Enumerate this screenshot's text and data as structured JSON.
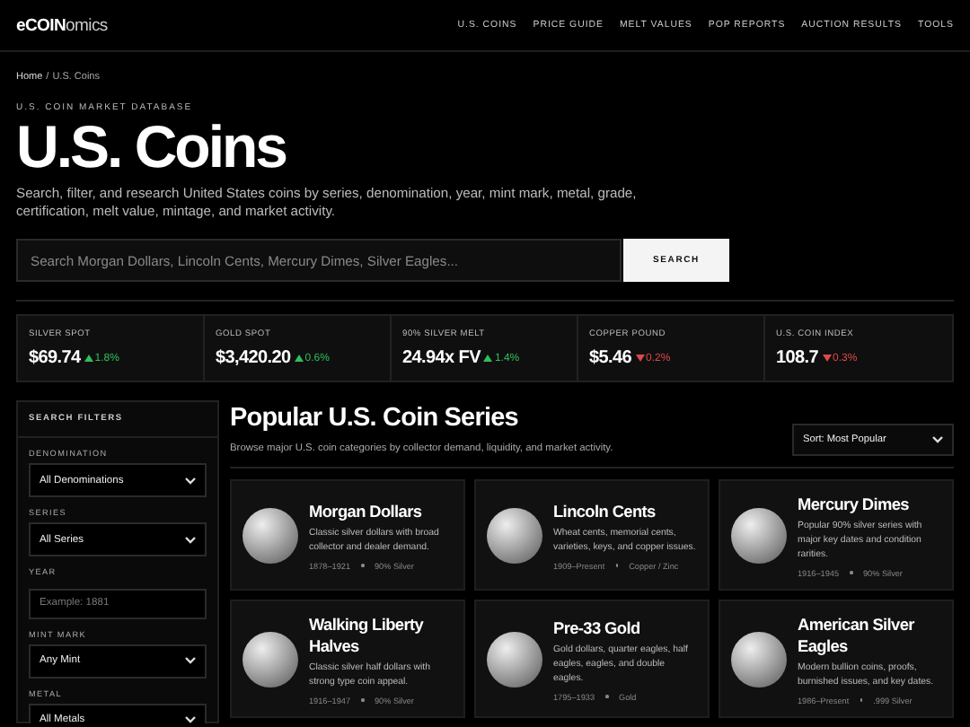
{
  "logo": {
    "bold": "eCOIN",
    "rest": "omics"
  },
  "nav": [
    "U.S. COINS",
    "PRICE GUIDE",
    "MELT VALUES",
    "POP REPORTS",
    "AUCTION RESULTS",
    "TOOLS"
  ],
  "breadcrumb": {
    "home": "Home",
    "separator": "/",
    "current": "U.S. Coins"
  },
  "eyebrow": "U.S. COIN MARKET DATABASE",
  "title": "U.S. Coins",
  "description": "Search, filter, and research United States coins by series, denomination, year, mint mark, metal, grade, certification, melt value, mintage, and market activity.",
  "search": {
    "placeholder": "Search Morgan Dollars, Lincoln Cents, Mercury Dimes, Silver Eagles...",
    "button": "SEARCH"
  },
  "stats": [
    {
      "label": "SILVER SPOT",
      "value": "$69.74",
      "change": "1.8%",
      "kind": "up"
    },
    {
      "label": "GOLD SPOT",
      "value": "$3,420.20",
      "change": "0.6%",
      "kind": "up"
    },
    {
      "label": "90% SILVER MELT",
      "value": "24.94x FV",
      "change": "1.4%",
      "kind": "up"
    },
    {
      "label": "COPPER POUND",
      "value": "$5.46",
      "change": "0.2%",
      "kind": "down"
    },
    {
      "label": "U.S. COIN INDEX",
      "value": "108.7",
      "change": "0.3%",
      "kind": "down"
    }
  ],
  "filters": {
    "title": "SEARCH FILTERS",
    "fields": [
      {
        "label": "DENOMINATION",
        "kind": "select",
        "value": "All Denominations"
      },
      {
        "label": "SERIES",
        "kind": "select",
        "value": "All Series"
      },
      {
        "label": "YEAR",
        "kind": "input",
        "placeholder": "Example: 1881"
      },
      {
        "label": "MINT MARK",
        "kind": "select",
        "value": "Any Mint"
      },
      {
        "label": "METAL",
        "kind": "select",
        "value": "All Metals"
      }
    ]
  },
  "series": {
    "title": "Popular U.S. Coin Series",
    "subtitle": "Browse major U.S. coin categories by collector demand, liquidity, and market activity.",
    "sort": "Sort: Most Popular",
    "cards": [
      {
        "name": "Morgan Dollars",
        "text": "Classic silver dollars with broad collector and dealer demand.",
        "years": "1878–1921",
        "metal": "90% Silver"
      },
      {
        "name": "Lincoln Cents",
        "text": "Wheat cents, memorial cents, varieties, keys, and copper issues.",
        "years": "1909–Present",
        "metal": "Copper / Zinc"
      },
      {
        "name": "Mercury Dimes",
        "text": "Popular 90% silver series with major key dates and condition rarities.",
        "years": "1916–1945",
        "metal": "90% Silver"
      },
      {
        "name": "Walking Liberty Halves",
        "text": "Classic silver half dollars with strong type coin appeal.",
        "years": "1916–1947",
        "metal": "90% Silver"
      },
      {
        "name": "Pre-33 Gold",
        "text": "Gold dollars, quarter eagles, half eagles, eagles, and double eagles.",
        "years": "1795–1933",
        "metal": "Gold"
      },
      {
        "name": "American Silver Eagles",
        "text": "Modern bullion coins, proofs, burnished issues, and key dates.",
        "years": "1986–Present",
        "metal": ".999 Silver"
      }
    ]
  }
}
